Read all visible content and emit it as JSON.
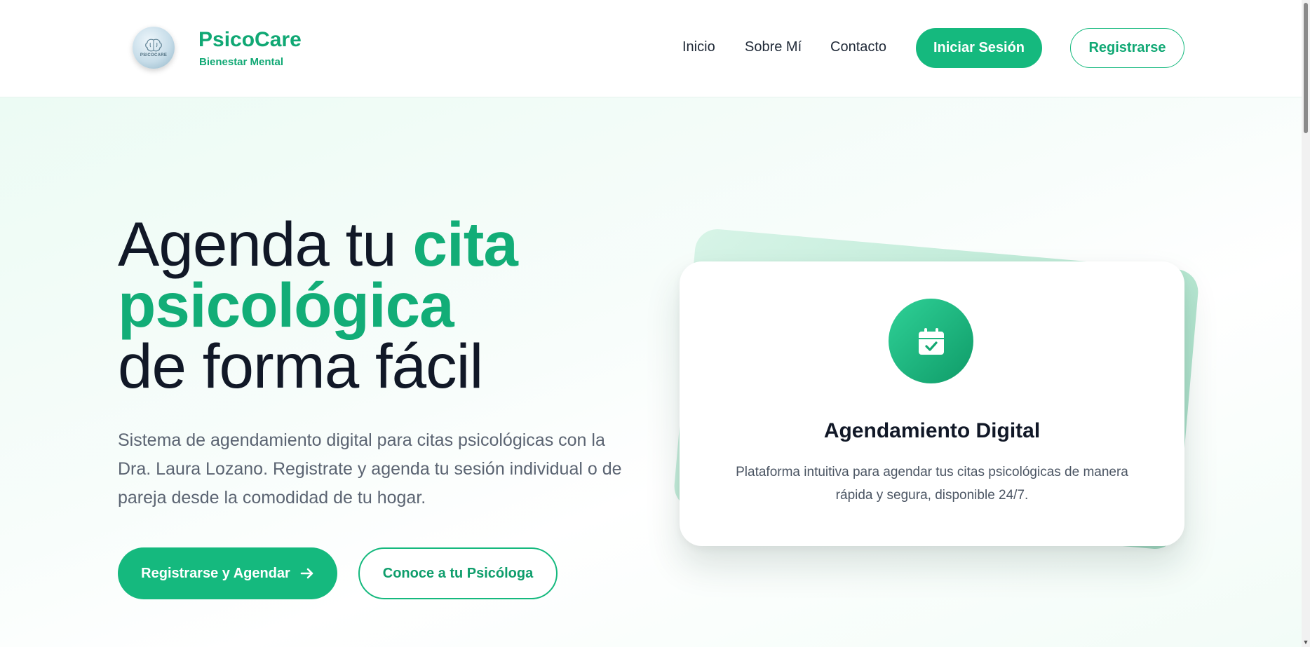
{
  "brand": {
    "logo_text": "PSICOCARE",
    "name": "PsicoCare",
    "tagline": "Bienestar Mental"
  },
  "nav": {
    "links": [
      "Inicio",
      "Sobre Mí",
      "Contacto"
    ],
    "login_label": "Iniciar Sesión",
    "register_label": "Registrarse"
  },
  "hero": {
    "title_part1": "Agenda tu ",
    "title_accent1": "cita",
    "title_accent2": "psicológica",
    "title_part3": "de forma fácil",
    "description": "Sistema de agendamiento digital para citas psicológicas con la Dra. Laura Lozano. Registrate y agenda tu sesión individual o de pareja desde la comodidad de tu hogar.",
    "primary_button": "Registrarse y Agendar",
    "secondary_button": "Conoce a tu Psicóloga"
  },
  "feature_card": {
    "icon": "calendar-check-icon",
    "title": "Agendamiento Digital",
    "text": "Plataforma intuitiva para agendar tus citas psicológicas de manera rápida y segura, disponible 24/7."
  },
  "colors": {
    "accent": "#15b97e",
    "accent_dark": "#10a874",
    "text_dark": "#111827",
    "text_muted": "#5b6472"
  }
}
